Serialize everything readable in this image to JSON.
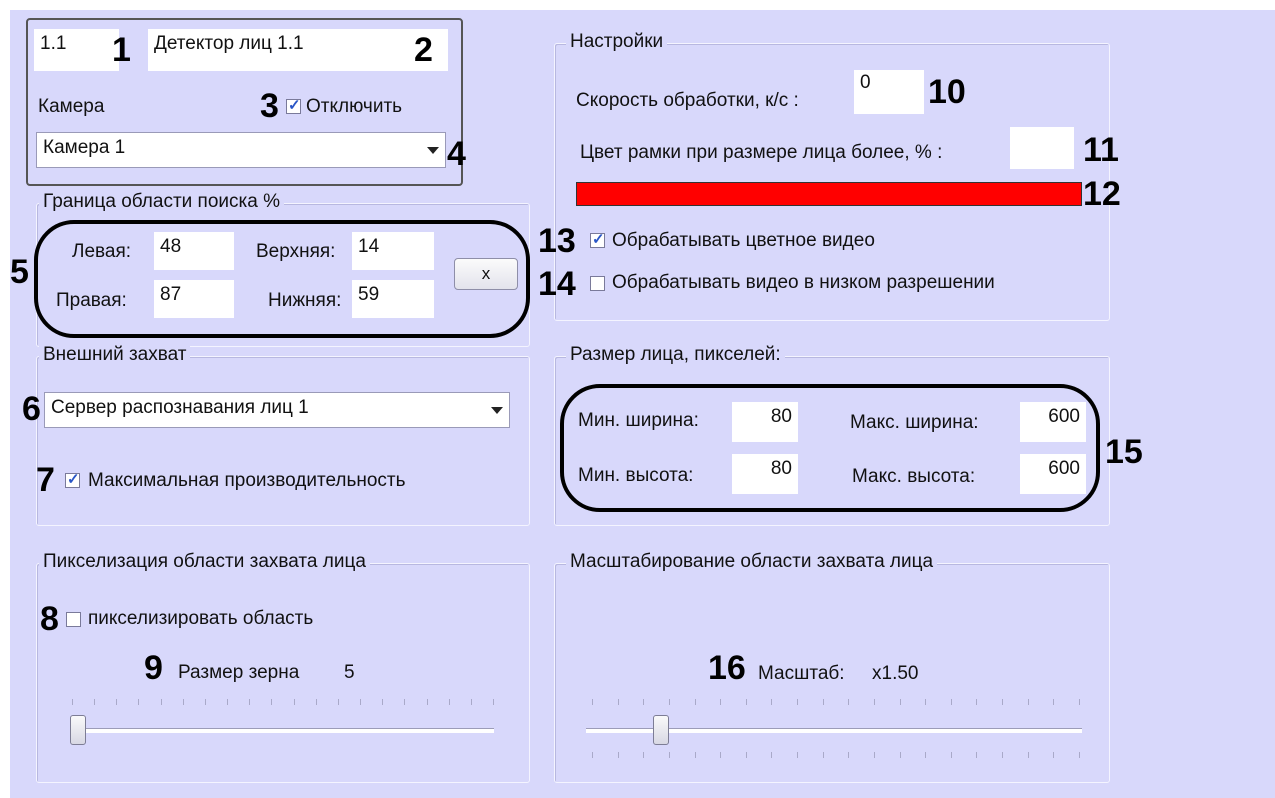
{
  "header": {
    "id_value": "1.1",
    "name_value": "Детектор лиц 1.1",
    "camera_label": "Камера",
    "disable_label": "Отключить",
    "camera_value": "Камера 1"
  },
  "search_area": {
    "legend": "Граница области поиска %",
    "left_label": "Левая:",
    "left_value": "48",
    "top_label": "Верхняя:",
    "top_value": "14",
    "right_label": "Правая:",
    "right_value": "87",
    "bottom_label": "Нижняя:",
    "bottom_value": "59",
    "reset_label": "x"
  },
  "external_capture": {
    "legend": "Внешний захват",
    "server_value": "Сервер распознавания лиц 1",
    "max_perf_label": "Максимальная производительность"
  },
  "pixelation": {
    "legend": "Пикселизация области захвата лица",
    "checkbox_label": "пикселизировать область",
    "grain_label": "Размер зерна",
    "grain_value": "5",
    "slider_fraction": 0.0
  },
  "settings": {
    "legend": "Настройки",
    "speed_label": "Скорость обработки, к/с :",
    "speed_value": "0",
    "frame_color_label": "Цвет рамки при размере лица более, % :",
    "frame_color_value": "",
    "color_bar": "#ff0000",
    "color_video_label": "Обрабатывать цветное видео",
    "low_res_label": "Обрабатывать видео в низком разрешении"
  },
  "face_size": {
    "legend": "Размер лица, пикселей:",
    "min_width_label": "Мин. ширина:",
    "min_width_value": "80",
    "max_width_label": "Макс. ширина:",
    "max_width_value": "600",
    "min_height_label": "Мин. высота:",
    "min_height_value": "80",
    "max_height_label": "Макс. высота:",
    "max_height_value": "600"
  },
  "scaling": {
    "legend": "Масштабирование области захвата лица",
    "scale_label": "Масштаб:",
    "scale_value": "x1.50",
    "slider_fraction": 0.14
  },
  "callouts": [
    "1",
    "2",
    "3",
    "4",
    "5",
    "6",
    "7",
    "8",
    "9",
    "10",
    "11",
    "12",
    "13",
    "14",
    "15",
    "16"
  ],
  "colors": {
    "panel": "#d8d8fb",
    "oval": "#000000",
    "accent_red": "#ff0000",
    "check": "#2a56c6"
  }
}
